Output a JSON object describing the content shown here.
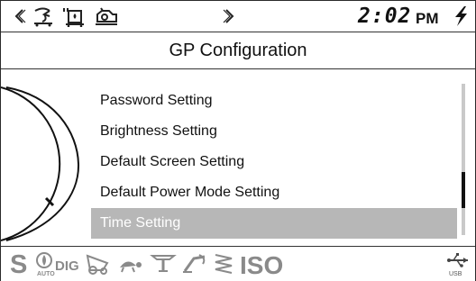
{
  "status_bar": {
    "time": "2:02",
    "ampm": "PM",
    "icons": [
      "left-arrow-icon",
      "recirculation-icon",
      "defrost-icon",
      "engine-lamp-icon",
      "right-arrow-icon",
      "lightning-icon"
    ]
  },
  "header": {
    "title": "GP Configuration"
  },
  "menu": {
    "items": [
      {
        "label": "Password Setting"
      },
      {
        "label": "Brightness Setting"
      },
      {
        "label": "Default Screen Setting"
      },
      {
        "label": "Default Power Mode Setting"
      },
      {
        "label": "Time Setting"
      }
    ],
    "selected_index": 4
  },
  "bottom_bar": {
    "s_label": "S",
    "auto_label": "AUTO",
    "dig_label": "DIG",
    "iso_label": "ISO",
    "usb_label": "USB",
    "icons": [
      "auto-throttle-icon",
      "tractor-icon",
      "turtle-icon",
      "cutting-tool-icon",
      "lift-arm-icon",
      "spring-icon",
      "usb-icon"
    ]
  },
  "colors": {
    "selection_bg": "#b7b7b7",
    "indicator_gray": "#8a8a8a",
    "frame": "#2a2a2a"
  }
}
